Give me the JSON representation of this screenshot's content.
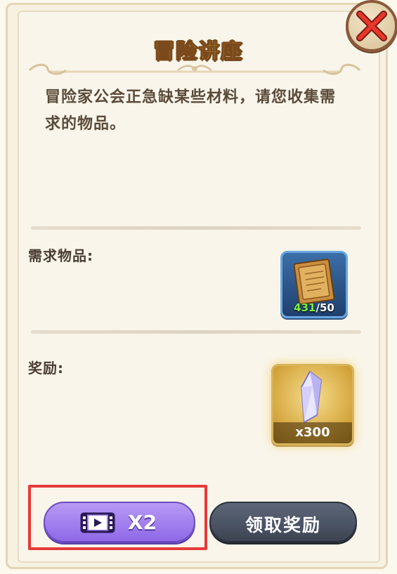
{
  "dialog": {
    "title": "冒险讲座",
    "description": "冒险家公会正急缺某些材料，请您收集需求的物品。"
  },
  "requirement": {
    "label": "需求物品:",
    "item": {
      "icon": "ancient-scroll-icon",
      "have": "431",
      "separator": "/",
      "need": "50"
    }
  },
  "reward": {
    "label": "奖励:",
    "item": {
      "icon": "crystal-shard-icon",
      "amount": "x300"
    }
  },
  "buttons": {
    "video_label": "X2",
    "claim_label": "领取奖励"
  },
  "colors": {
    "title": "#f7c349",
    "have_count": "#7cf23d",
    "video_button": "#a784f0",
    "claim_button": "#4a5264",
    "highlight": "#e63a3a"
  }
}
